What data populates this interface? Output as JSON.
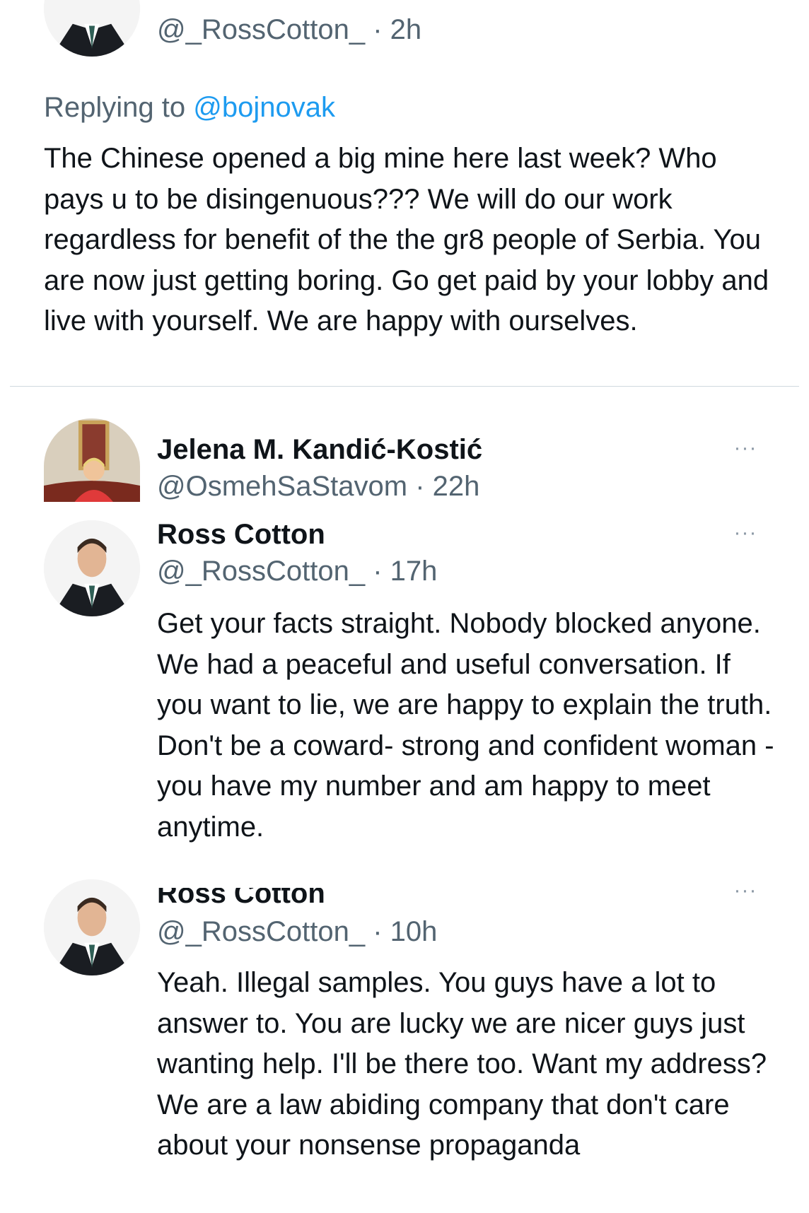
{
  "tweet1": {
    "handle": "@_RossCotton_",
    "time": "· 2h",
    "replying_prefix": "Replying to",
    "replying_to": "@bojnovak",
    "text": "The Chinese opened a big mine here last week? Who pays u to be disingenuous??? We will do our work regardless for benefit of the the gr8 people of Serbia. You are now just getting boring. Go get paid by your lobby and live with yourself. We are happy with ourselves."
  },
  "tweet2": {
    "name": "Jelena M. Kandić-Kostić",
    "handle": "@OsmehSaStavom",
    "time": "· 22h",
    "more_icon": "···"
  },
  "tweet3": {
    "name": "Ross Cotton",
    "handle": "@_RossCotton_",
    "time": "· 17h",
    "more_icon": "···",
    "text": "Get your facts straight. Nobody blocked anyone. We had a peaceful and useful conversation. If you want to lie, we are happy to explain the truth. Don't be a coward- strong and confident woman - you have my number and am happy to meet anytime."
  },
  "tweet4": {
    "name": "Ross Cotton",
    "handle": "@_RossCotton_",
    "time": "· 10h",
    "more_icon": "···",
    "text": "Yeah. Illegal samples. You guys have a lot to answer to. You are lucky we are nicer guys just wanting help. I'll be there too. Want my address? We are a law abiding company that don't care about your nonsense propaganda"
  },
  "colors": {
    "text": "#0f1419",
    "secondary": "#536471",
    "link": "#1d9bf0",
    "divider": "#cfd9de"
  }
}
